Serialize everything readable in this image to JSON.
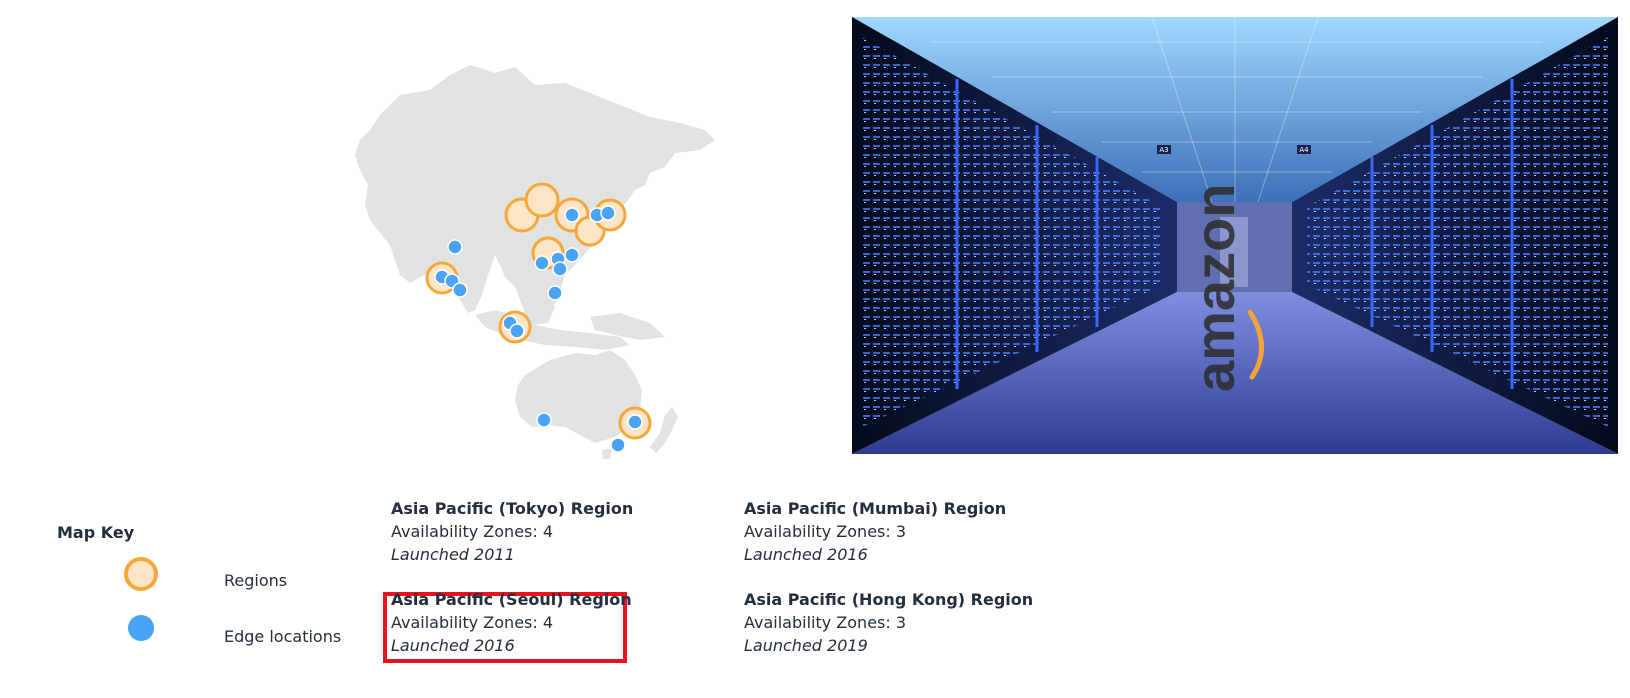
{
  "map_key": {
    "title": "Map Key",
    "regions_label": "Regions",
    "edge_locations_label": "Edge locations",
    "region_symbol_icon": "region-circle-icon",
    "edge_symbol_icon": "edge-dot-icon"
  },
  "regions": [
    {
      "name": "Asia Pacific (Tokyo) Region",
      "zones": "Availability Zones: 4",
      "launched": "Launched 2011"
    },
    {
      "name": "Asia Pacific (Mumbai) Region",
      "zones": "Availability Zones: 3",
      "launched": "Launched 2016"
    },
    {
      "name": "Asia Pacific (Seoul) Region",
      "zones": "Availability Zones: 4",
      "launched": "Launched 2016",
      "highlighted": true
    },
    {
      "name": "Asia Pacific (Hong Kong) Region",
      "zones": "Availability Zones: 3",
      "launched": "Launched 2019"
    }
  ],
  "photo": {
    "logo_text": "amazon",
    "aisle_signs": [
      "A3",
      "A4"
    ]
  },
  "colors": {
    "region_fill": "#fde6c7",
    "region_stroke": "#f5a83a",
    "edge_location": "#4aa3f5",
    "land": "#e2e2e2",
    "highlight": "#e8131e",
    "text": "#232f3e"
  }
}
